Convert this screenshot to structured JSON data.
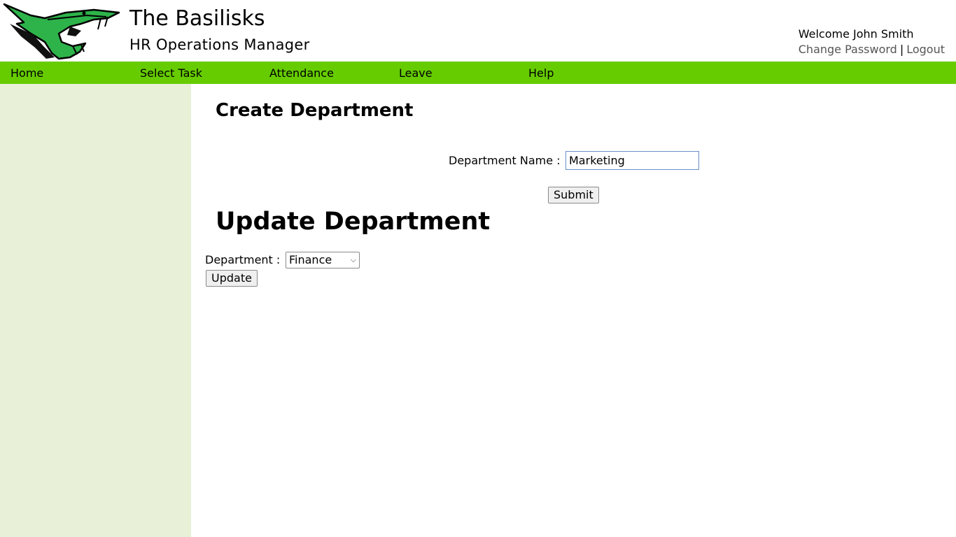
{
  "header": {
    "title": "The Basilisks",
    "subtitle": "HR Operations Manager",
    "welcome": "Welcome John Smith",
    "change_password": "Change Password",
    "separator": "|",
    "logout": "Logout"
  },
  "nav": {
    "items": [
      {
        "label": "Home"
      },
      {
        "label": "Select Task"
      },
      {
        "label": "Attendance"
      },
      {
        "label": "Leave"
      },
      {
        "label": "Help"
      }
    ]
  },
  "create": {
    "title": "Create Department",
    "field_label": "Department Name :",
    "field_value": "Marketing",
    "submit_label": "Submit"
  },
  "update": {
    "title": "Update Department",
    "select_label": "Department :",
    "selected": "Finance",
    "update_label": "Update"
  },
  "colors": {
    "nav_bg": "#66cc00",
    "sidebar_bg": "#e8f0d8",
    "logo_green": "#2db34a"
  }
}
